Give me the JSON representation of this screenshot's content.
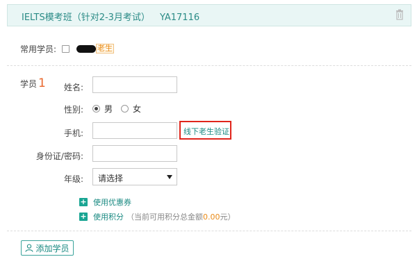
{
  "course": {
    "title": "IELTS模考班（针对2-3月考试）",
    "code": "YA17116"
  },
  "regular_students": {
    "label": "常用学员:",
    "badge": "老生"
  },
  "student": {
    "label": "学员",
    "number": "1"
  },
  "form": {
    "name_label": "姓名:",
    "name_value": "",
    "gender_label": "性别:",
    "gender_male": "男",
    "gender_female": "女",
    "gender_selected": "男",
    "phone_label": "手机:",
    "phone_value": "",
    "verify_link": "线下老生验证",
    "id_label": "身份证/密码:",
    "id_value": "",
    "grade_label": "年级:",
    "grade_selected": "请选择"
  },
  "extras": {
    "coupon": "使用优惠券",
    "points": "使用积分",
    "points_hint_prefix": "（当前可用积分总金额",
    "points_amount": "0.00",
    "points_hint_suffix": "元）"
  },
  "add_student_label": "添加学员",
  "colors": {
    "accent": "#1a8a82",
    "highlight_border": "#e0251b",
    "badge": "#e98a16",
    "header_bg": "#e9f6f5"
  },
  "icons": [
    "trash-icon",
    "plus-icon",
    "user-icon",
    "chevron-down-icon"
  ]
}
